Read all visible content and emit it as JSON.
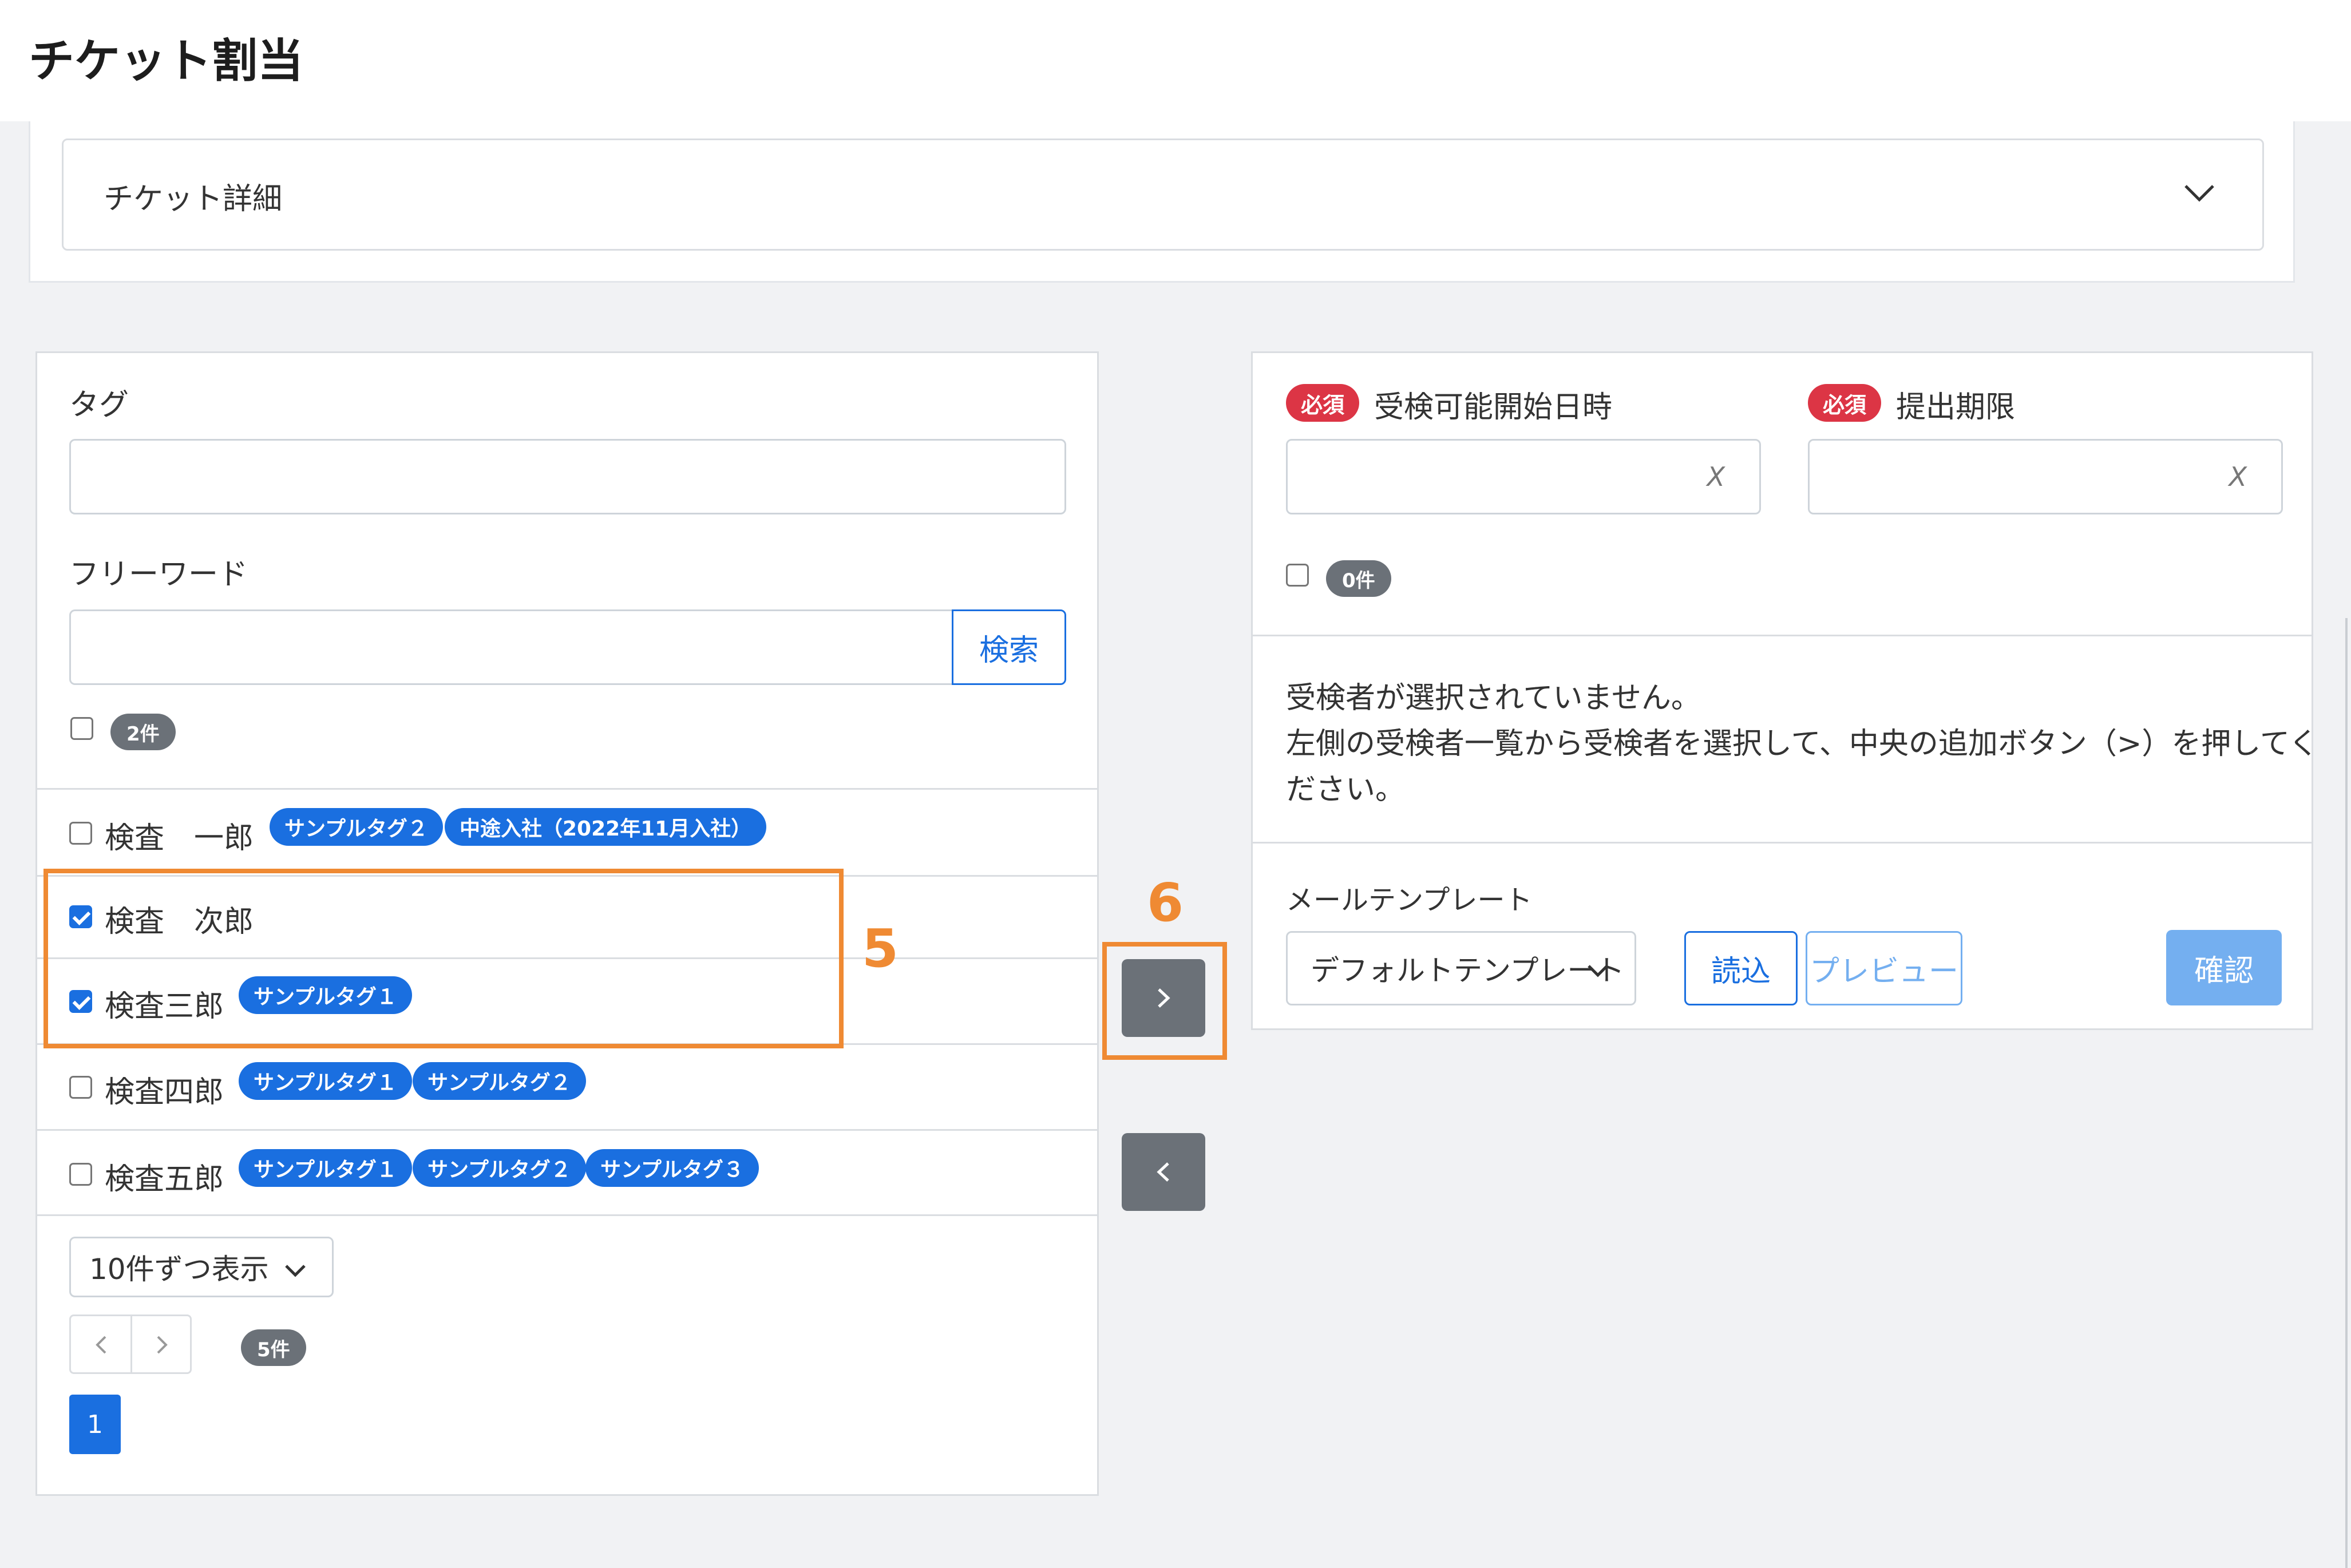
{
  "page": {
    "title": "チケット割当"
  },
  "ticket_detail": {
    "label": "チケット詳細"
  },
  "left_panel": {
    "tag_label": "タグ",
    "freeword_label": "フリーワード",
    "search_button": "検索",
    "count_badge": "2件",
    "candidates": [
      {
        "name": "検査　一郎",
        "checked": false,
        "tags": [
          "サンプルタグ２",
          "中途入社（2022年11月入社）"
        ]
      },
      {
        "name": "検査　次郎",
        "checked": true,
        "tags": []
      },
      {
        "name": "検査三郎",
        "checked": true,
        "tags": [
          "サンプルタグ１"
        ]
      },
      {
        "name": "検査四郎",
        "checked": false,
        "tags": [
          "サンプルタグ１",
          "サンプルタグ２"
        ]
      },
      {
        "name": "検査五郎",
        "checked": false,
        "tags": [
          "サンプルタグ１",
          "サンプルタグ２",
          "サンプルタグ３"
        ]
      }
    ],
    "per_page_select": "10件ずつ表示",
    "total_badge": "5件",
    "current_page": "1"
  },
  "annotations": {
    "step5": "5",
    "step6": "6"
  },
  "right_panel": {
    "required_badge": "必須",
    "start_label": "受検可能開始日時",
    "deadline_label": "提出期限",
    "clear_symbol": "X",
    "selected_count": "0件",
    "empty_message_1": "受検者が選択されていません。",
    "empty_message_2": "左側の受検者一覧から受検者を選択して、中央の追加ボタン（>）を押してく",
    "empty_message_3": "ださい。",
    "mail_template_label": "メールテンプレート",
    "template_select": "デフォルトテンプレート",
    "load_button": "読込",
    "preview_button": "プレビュー",
    "confirm_button": "確認"
  },
  "colors": {
    "primary": "#1a6fe0",
    "danger": "#dc3545",
    "secondary": "#6b7178",
    "highlight": "#ef8a33"
  },
  "icons": {
    "accordion": "chevron-down-icon",
    "add": "chevron-right-icon",
    "remove": "chevron-left-icon"
  }
}
